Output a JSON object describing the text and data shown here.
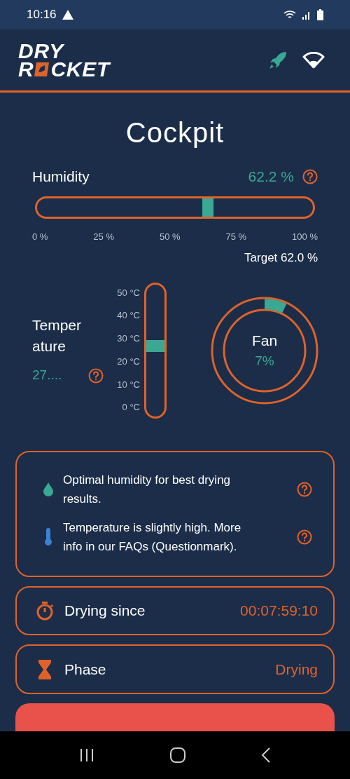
{
  "status_bar": {
    "time": "10:16"
  },
  "logo": {
    "line_1": "DRY",
    "line_2_start": "R",
    "line_2_end": "CKET"
  },
  "title": "Cockpit",
  "humidity": {
    "label": "Humidity",
    "reading": "62.2 %",
    "level": 0.62,
    "ticks": [
      "0 %",
      "25 %",
      "50 %",
      "75 %",
      "100 %"
    ],
    "target": "Target 62.0 %"
  },
  "temperature": {
    "label_lines": [
      "Temper",
      "ature"
    ],
    "reading": "27....",
    "level": 0.53,
    "ticks": [
      "50 °C",
      "40 °C",
      "30 °C",
      "20 °C",
      "10 °C",
      "0 °C"
    ]
  },
  "fan": {
    "label": "Fan",
    "reading": "7%"
  },
  "messages": [
    {
      "kind": "humidity",
      "text": "Optimal humidity for best drying results."
    },
    {
      "kind": "temperature",
      "text": "Temperature is slightly high. More info in our FAQs (Questionmark)."
    }
  ],
  "info_rows": [
    {
      "kind": "timer",
      "label": "Drying since",
      "value": "00:07:59:10"
    },
    {
      "kind": "phase",
      "label": "Phase",
      "value": "Drying"
    }
  ]
}
